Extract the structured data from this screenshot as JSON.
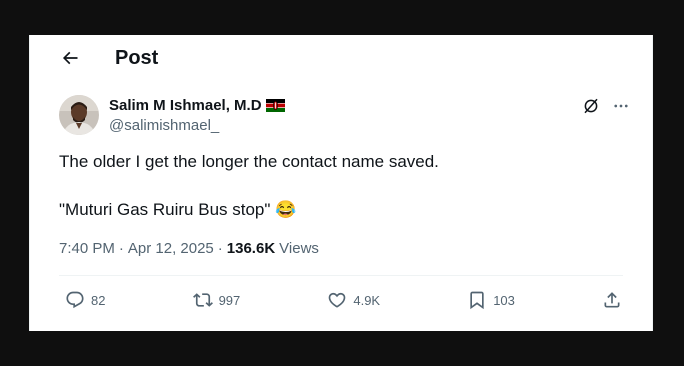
{
  "header": {
    "title": "Post"
  },
  "author": {
    "display_name": "Salim M Ishmael, M.D",
    "handle": "@salimishmael_",
    "flag_icon": "kenya-flag-icon"
  },
  "tweet": {
    "line1": "The older I get the longer the contact name saved.",
    "line2": "\"Muturi Gas Ruiru Bus stop\"",
    "emoji": "😂"
  },
  "meta": {
    "time": "7:40 PM",
    "separator": "·",
    "date": "Apr 12, 2025",
    "views_count": "136.6K",
    "views_label": "Views"
  },
  "actions": {
    "replies": "82",
    "reposts": "997",
    "likes": "4.9K",
    "bookmarks": "103"
  },
  "colors": {
    "text": "#0f1419",
    "secondary": "#536471",
    "background_outer": "#0f0f0f"
  }
}
